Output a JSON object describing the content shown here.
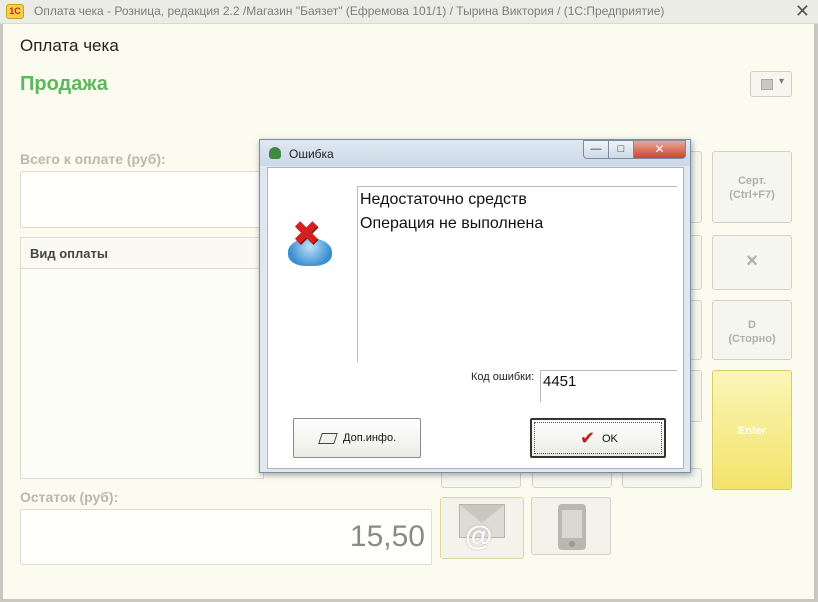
{
  "window": {
    "app_icon_text": "1С",
    "title": "Оплата чека - Розница, редакция 2.2 /Магазин \"Баязет\" (Ефремова 101/1) / Тырина Виктория / (1С:Предприятие)",
    "close_glyph": "✕"
  },
  "form": {
    "title": "Оплата чека",
    "operation": "Продажа",
    "total_label": "Всего к оплате (руб):",
    "total_value": "",
    "pay_type_header": "Вид оплаты",
    "remainder_label": "Остаток (руб):",
    "remainder_value": "15,50"
  },
  "side_buttons": {
    "cert": "Серт.",
    "cert_shortcut": "(Ctrl+F7)",
    "clear": "×",
    "storno_key": "D",
    "storno": "(Сторно)",
    "enter": "Enter"
  },
  "dialog": {
    "title": "Ошибка",
    "min_glyph": "—",
    "max_glyph": "□",
    "close_glyph": "✕",
    "message_line1": "Недостаточно средств",
    "message_line2": "Операция не выполнена",
    "error_code_label": "Код ошибки:",
    "error_code": "4451",
    "more_info_button": "Доп.инфо.",
    "ok_button": "OK"
  }
}
